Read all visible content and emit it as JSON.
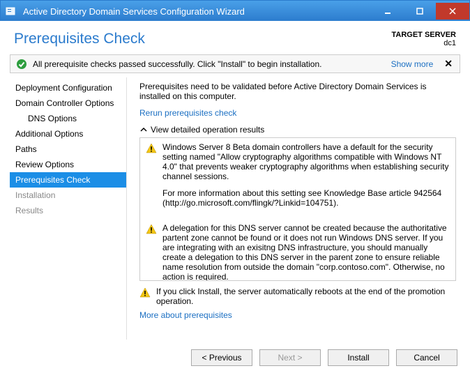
{
  "window": {
    "title": "Active Directory Domain Services Configuration Wizard"
  },
  "header": {
    "page_title": "Prerequisites Check",
    "target_label": "TARGET SERVER",
    "target_value": "dc1"
  },
  "banner": {
    "message": "All prerequisite checks passed successfully. Click \"Install\" to begin installation.",
    "show_more": "Show more",
    "close": "✕"
  },
  "nav": {
    "items": [
      {
        "label": "Deployment Configuration",
        "selected": false
      },
      {
        "label": "Domain Controller Options",
        "selected": false
      },
      {
        "label": "DNS Options",
        "selected": false,
        "sub": true
      },
      {
        "label": "Additional Options",
        "selected": false
      },
      {
        "label": "Paths",
        "selected": false
      },
      {
        "label": "Review Options",
        "selected": false
      },
      {
        "label": "Prerequisites Check",
        "selected": true
      },
      {
        "label": "Installation",
        "selected": false,
        "disabled": true
      },
      {
        "label": "Results",
        "selected": false,
        "disabled": true
      }
    ]
  },
  "main": {
    "intro": "Prerequisites need to be validated before Active Directory Domain Services is installed on this computer.",
    "rerun_link": "Rerun prerequisites check",
    "results_header": "View detailed operation results",
    "warnings": [
      {
        "p1": "Windows Server 8 Beta domain controllers have a default for the security setting named \"Allow cryptography algorithms compatible with Windows NT 4.0\" that prevents weaker cryptography algorithms when establishing security channel sessions.",
        "p2": "For more information about this setting see Knowledge Base article 942564 (http://go.microsoft.com/flingk/?Linkid=104751)."
      },
      {
        "p1": "A delegation for this DNS server cannot be created because the authoritative partent zone cannot be found or it does not run Windows DNS server. If you are integrating with an exisitng DNS infrastructure, you should manually create a delegation to this DNS server in the parent zone to ensure reliable name resolution from outside the domain \"corp.contoso.com\". Otherwise, no action is required."
      }
    ],
    "footer_warning": "If you click Install, the server automatically reboots at the end of the promotion operation.",
    "more_link": "More about prerequisites"
  },
  "buttons": {
    "previous": "< Previous",
    "next": "Next >",
    "install": "Install",
    "cancel": "Cancel"
  }
}
